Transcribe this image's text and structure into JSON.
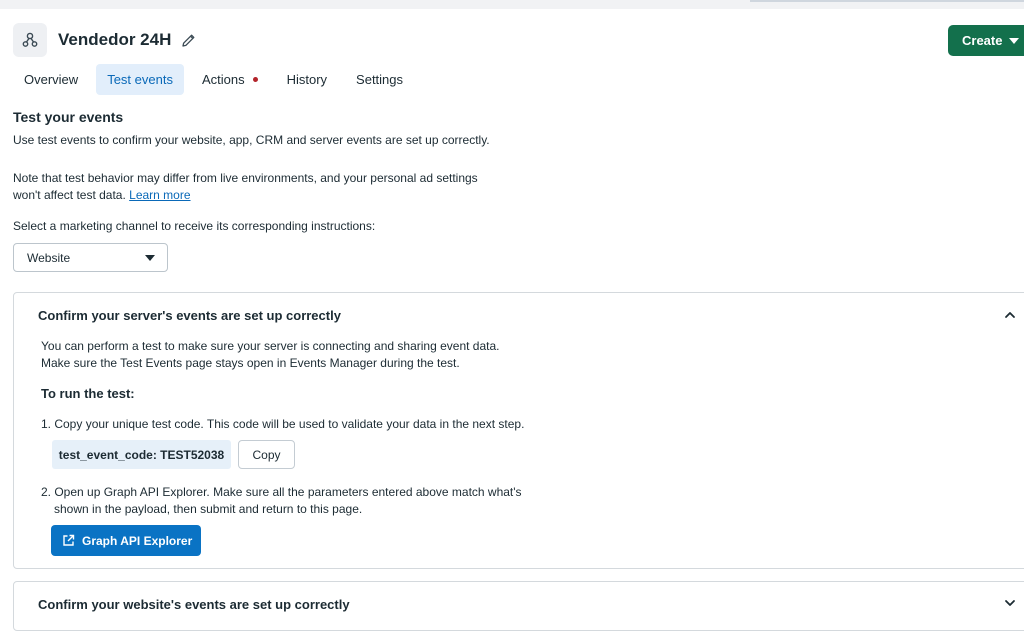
{
  "header": {
    "title": "Vendedor 24H",
    "create_label": "Create"
  },
  "tabs": [
    {
      "label": "Overview"
    },
    {
      "label": "Test events"
    },
    {
      "label": "Actions"
    },
    {
      "label": "History"
    },
    {
      "label": "Settings"
    }
  ],
  "intro": {
    "title": "Test your events",
    "line1": "Use test events to confirm your website, app, CRM and server events are set up correctly.",
    "note_line1": "Note that test behavior may differ from live environments, and your personal ad settings",
    "note_line2": "won't affect test data.",
    "learn_more": "Learn more",
    "select_label": "Select a marketing channel to receive its corresponding instructions:",
    "channel_value": "Website"
  },
  "server_card": {
    "title": "Confirm your server's events are set up correctly",
    "desc_line1": "You can perform a test to make sure your server is connecting and sharing event data.",
    "desc_line2": "Make sure the Test Events page stays open in Events Manager during the test.",
    "run_title": "To run the test:",
    "step1": "1.  Copy your unique test code. This code will be used to validate your data in the next step.",
    "test_code": "test_event_code: TEST52038",
    "copy_label": "Copy",
    "step2_line1": "2. Open up Graph API Explorer. Make sure all the parameters entered above match what's",
    "step2_line2": "shown in the payload, then submit and return to this page.",
    "graph_button": "Graph API Explorer"
  },
  "website_card": {
    "title": "Confirm your website's events are set up correctly"
  }
}
